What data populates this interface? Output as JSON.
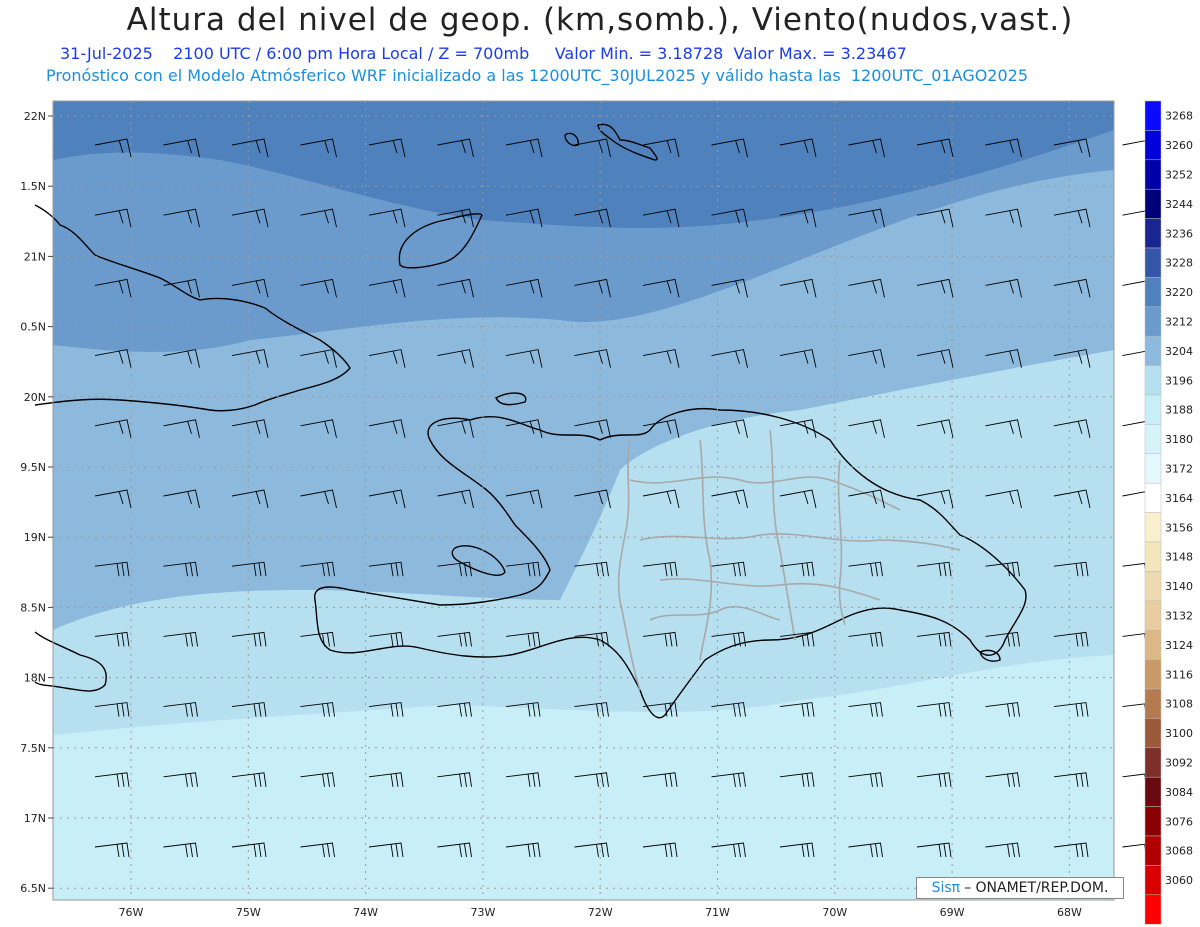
{
  "header": {
    "title": "Altura del nivel de geop. (km,somb.), Viento(nudos,vast.)",
    "date": "31-Jul-2025",
    "time": "2100 UTC / 6:00 pm Hora Local / Z = 700mb",
    "min_label": "Valor Min. = 3.18728",
    "max_label": "Valor Max. = 3.23467",
    "forecast": "Pronóstico con el Modelo Atmósferico WRF inicializado a las 1200UTC_30JUL2025 y válido hasta las  1200UTC_01AGO2025"
  },
  "map": {
    "lat_labels": [
      "22N",
      "1.5N",
      "21N",
      "0.5N",
      "20N",
      "9.5N",
      "19N",
      "8.5N",
      "18N",
      "7.5N",
      "17N",
      "6.5N"
    ],
    "lon_labels": [
      "76W",
      "75W",
      "74W",
      "73W",
      "72W",
      "71W",
      "70W",
      "69W",
      "68W"
    ],
    "lat_range": [
      16.5,
      22.0
    ],
    "lon_range": [
      -76.7,
      -67.6
    ],
    "fill_colors": {
      "deep": "#4f82bd",
      "mid": "#6b9bcc",
      "light_mid": "#8cb9dc",
      "pale": "#b6dff0",
      "palest": "#c8eef8"
    }
  },
  "colorbar": {
    "labels": [
      "3268",
      "3260",
      "3252",
      "3244",
      "3236",
      "3228",
      "3220",
      "3212",
      "3204",
      "3196",
      "3188",
      "3180",
      "3172",
      "3164",
      "3156",
      "3148",
      "3140",
      "3132",
      "3124",
      "3116",
      "3108",
      "3100",
      "3092",
      "3084",
      "3076",
      "3068",
      "3060"
    ],
    "colors": [
      "#0a0aff",
      "#0000d8",
      "#0000a8",
      "#000078",
      "#1b2590",
      "#3555a8",
      "#4f82bd",
      "#6b9bcc",
      "#8cb9dc",
      "#b6dff0",
      "#c8eef8",
      "#d6f3fa",
      "#e4f8fd",
      "#ffffff",
      "#f8f0cc",
      "#f3e6bd",
      "#eedab0",
      "#e8cda0",
      "#dcb886",
      "#c99a68",
      "#b57b50",
      "#9c5a3c",
      "#7e2f2a",
      "#6a0a10",
      "#8a0000",
      "#b00000",
      "#d80000",
      "#ff0000"
    ]
  },
  "credit": {
    "sis": "Sisπ",
    "org": "– ONAMET/REP.DOM."
  }
}
